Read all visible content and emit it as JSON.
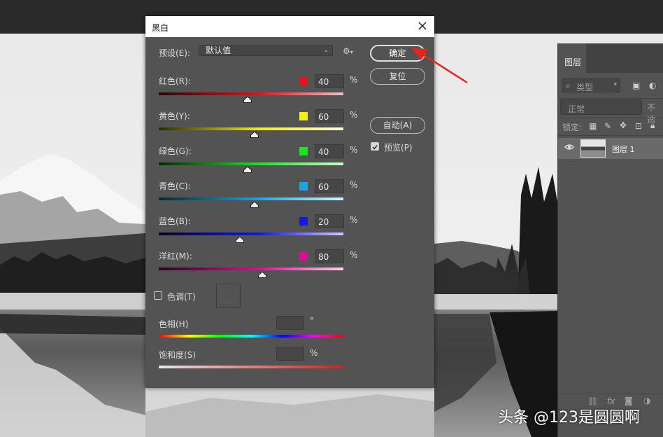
{
  "dialog": {
    "title": "黑白",
    "preset_label": "预设(E):",
    "preset_value": "默认值",
    "buttons": {
      "ok": "确定",
      "reset": "复位",
      "auto": "自动(A)"
    },
    "preview": {
      "label": "预览(P)",
      "checked": true
    },
    "sliders": [
      {
        "label": "红色(R):",
        "value": "40",
        "unit": "%",
        "color": "#e8111b",
        "fraction": 0.48
      },
      {
        "label": "黄色(Y):",
        "value": "60",
        "unit": "%",
        "color": "#f3ee17",
        "fraction": 0.52
      },
      {
        "label": "绿色(G):",
        "value": "40",
        "unit": "%",
        "color": "#19e61c",
        "fraction": 0.48
      },
      {
        "label": "青色(C):",
        "value": "60",
        "unit": "%",
        "color": "#1ea4e3",
        "fraction": 0.52
      },
      {
        "label": "蓝色(B):",
        "value": "20",
        "unit": "%",
        "color": "#1417e6",
        "fraction": 0.44
      },
      {
        "label": "洋红(M):",
        "value": "80",
        "unit": "%",
        "color": "#d51295",
        "fraction": 0.56
      }
    ],
    "tint": {
      "label": "色调(T)",
      "checked": false
    },
    "hue": {
      "label": "色相(H)",
      "unit": "°"
    },
    "saturation": {
      "label": "饱和度(S)",
      "unit": "%"
    }
  },
  "layers_panel": {
    "tab": "图层",
    "filter_kind": "类型",
    "blend_mode": "正常",
    "opacity_label": "不透",
    "lock_label": "锁定:",
    "layer": {
      "name": "图层 1"
    }
  },
  "watermark": "头条 @123是圆圆啊"
}
